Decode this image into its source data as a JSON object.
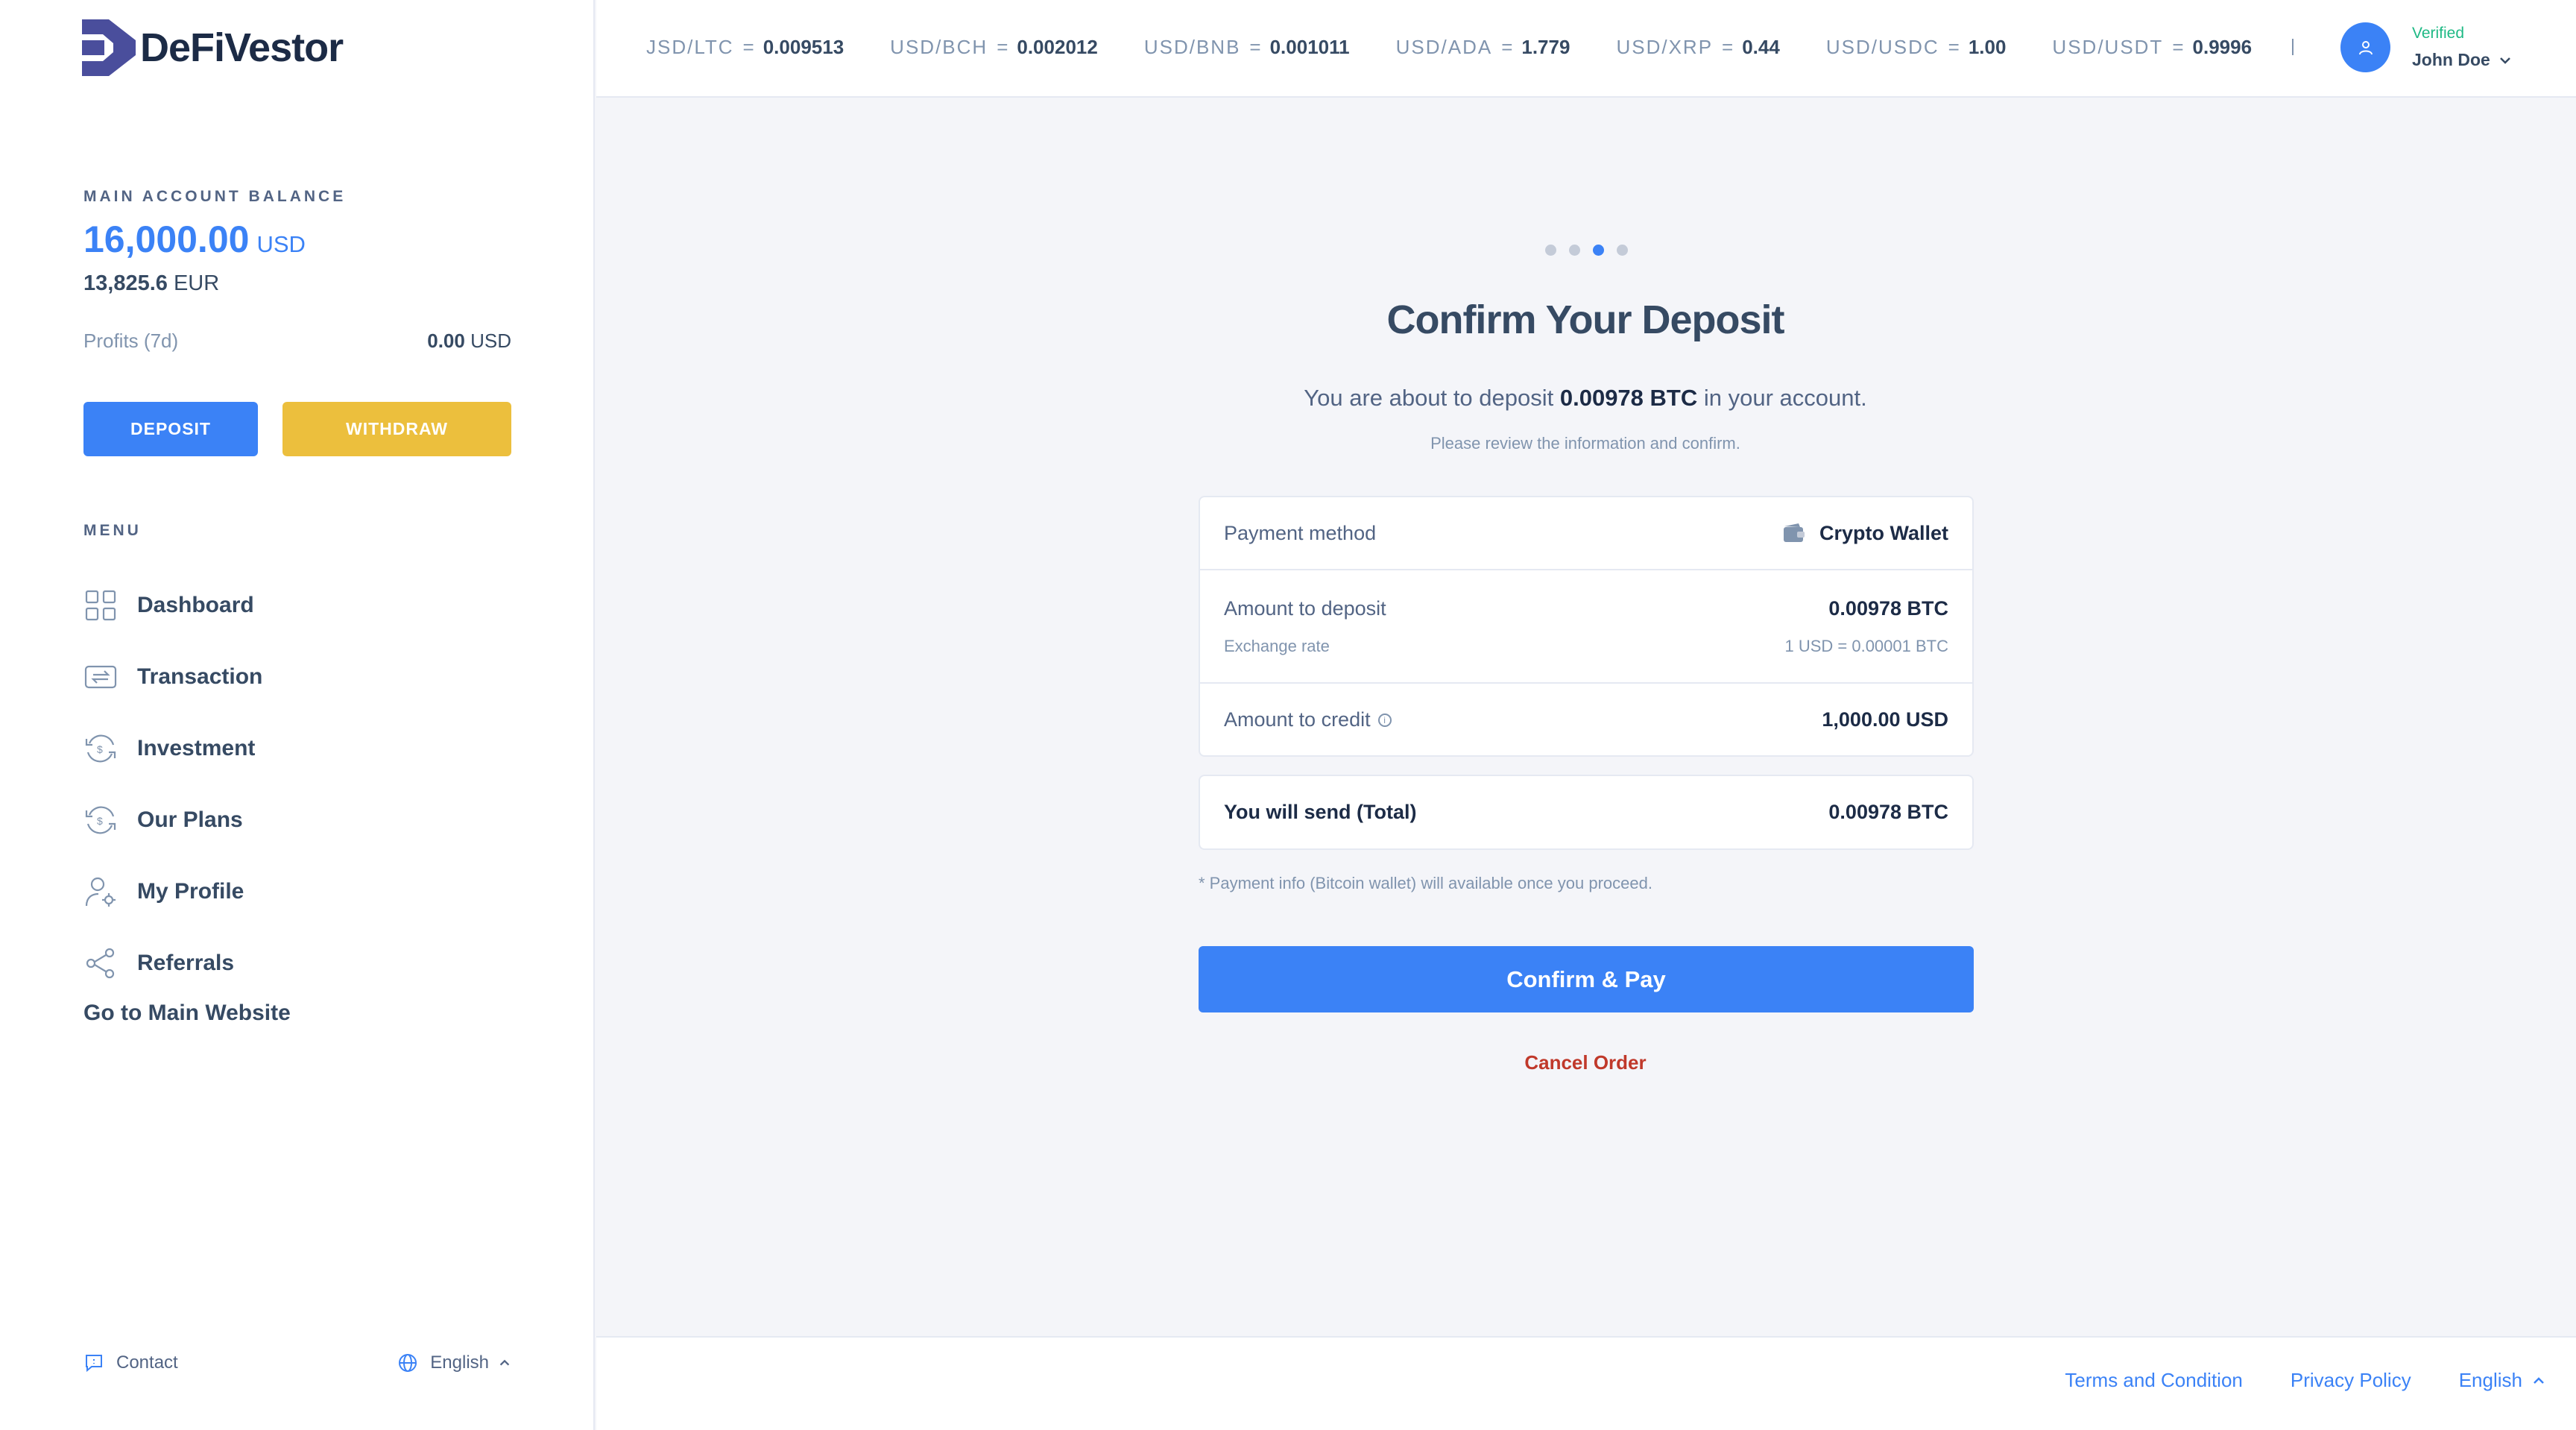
{
  "brand": {
    "name": "DeFiVestor"
  },
  "balance": {
    "title": "MAIN ACCOUNT BALANCE",
    "amount": "16,000.00",
    "currency": "USD",
    "eur_amount": "13,825.6",
    "eur_currency": "EUR",
    "profits_label": "Profits (7d)",
    "profits_value": "0.00",
    "profits_currency": "USD"
  },
  "actions": {
    "deposit": "DEPOSIT",
    "withdraw": "WITHDRAW"
  },
  "menu": {
    "title": "MENU",
    "items": [
      {
        "label": "Dashboard",
        "icon": "dashboard-icon"
      },
      {
        "label": "Transaction",
        "icon": "transaction-icon"
      },
      {
        "label": "Investment",
        "icon": "investment-icon"
      },
      {
        "label": "Our Plans",
        "icon": "plans-icon"
      },
      {
        "label": "My Profile",
        "icon": "profile-icon"
      },
      {
        "label": "Referrals",
        "icon": "share-icon"
      }
    ],
    "main_site": "Go to Main Website"
  },
  "sidebar_footer": {
    "contact": "Contact",
    "language": "English"
  },
  "ticker": [
    {
      "pair": "JSD/LTC",
      "value": "0.009513"
    },
    {
      "pair": "USD/BCH",
      "value": "0.002012"
    },
    {
      "pair": "USD/BNB",
      "value": "0.001011"
    },
    {
      "pair": "USD/ADA",
      "value": "1.779"
    },
    {
      "pair": "USD/XRP",
      "value": "0.44"
    },
    {
      "pair": "USD/USDC",
      "value": "1.00"
    },
    {
      "pair": "USD/USDT",
      "value": "0.9996"
    }
  ],
  "user": {
    "status": "Verified",
    "name": "John Doe"
  },
  "steps": {
    "total": 4,
    "current": 3
  },
  "confirm": {
    "title": "Confirm Your Deposit",
    "subtitle_pre": "You are about to deposit ",
    "subtitle_amount": "0.00978 BTC",
    "subtitle_post": " in your account.",
    "note": "Please review the information and confirm.",
    "payment_method_label": "Payment method",
    "payment_method_value": "Crypto Wallet",
    "amount_deposit_label": "Amount to deposit",
    "amount_deposit_value": "0.00978 BTC",
    "exchange_rate_label": "Exchange rate",
    "exchange_rate_value": "1 USD = 0.00001 BTC",
    "amount_credit_label": "Amount to credit",
    "amount_credit_value": "1,000.00 USD",
    "total_label": "You will send (Total)",
    "total_value": "0.00978 BTC",
    "payment_info": "* Payment info (Bitcoin wallet) will available once you proceed.",
    "confirm_button": "Confirm & Pay",
    "cancel": "Cancel Order"
  },
  "footer": {
    "terms": "Terms and Condition",
    "privacy": "Privacy Policy",
    "language": "English"
  },
  "colors": {
    "primary": "#3b82f6",
    "warning": "#ecbf3d",
    "danger": "#c0392b",
    "success": "#1fb985"
  }
}
